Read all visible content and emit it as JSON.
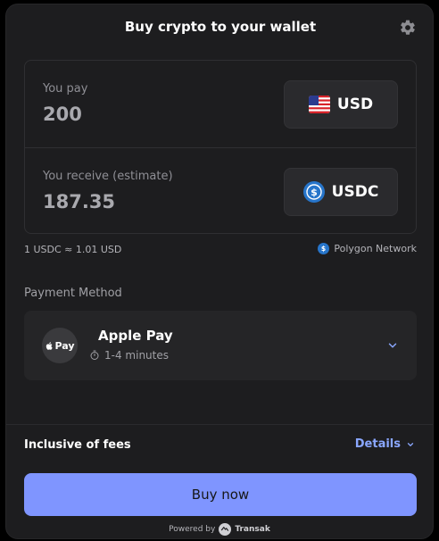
{
  "header": {
    "title": "Buy crypto to your wallet",
    "settings_icon": "gear-icon"
  },
  "pay": {
    "label": "You pay",
    "amount": "200",
    "currency": "USD",
    "currency_icon": "us-flag-icon"
  },
  "receive": {
    "label": "You receive (estimate)",
    "amount": "187.35",
    "currency": "USDC",
    "currency_icon": "usdc-icon"
  },
  "rate": {
    "text": "1 USDC ≈ 1.01 USD",
    "network": "Polygon Network"
  },
  "payment": {
    "section_label": "Payment Method",
    "logo_text": "Pay",
    "method": "Apple Pay",
    "eta": "1-4 minutes"
  },
  "fees": {
    "label": "Inclusive of fees",
    "details_label": "Details"
  },
  "action": {
    "buy_label": "Buy now"
  },
  "footer": {
    "powered_by": "Powered by",
    "brand": "Transak"
  },
  "colors": {
    "accent": "#7f95ff",
    "link": "#8aa7ff",
    "panel": "#1d1d1f",
    "usdc": "#2775ca"
  }
}
